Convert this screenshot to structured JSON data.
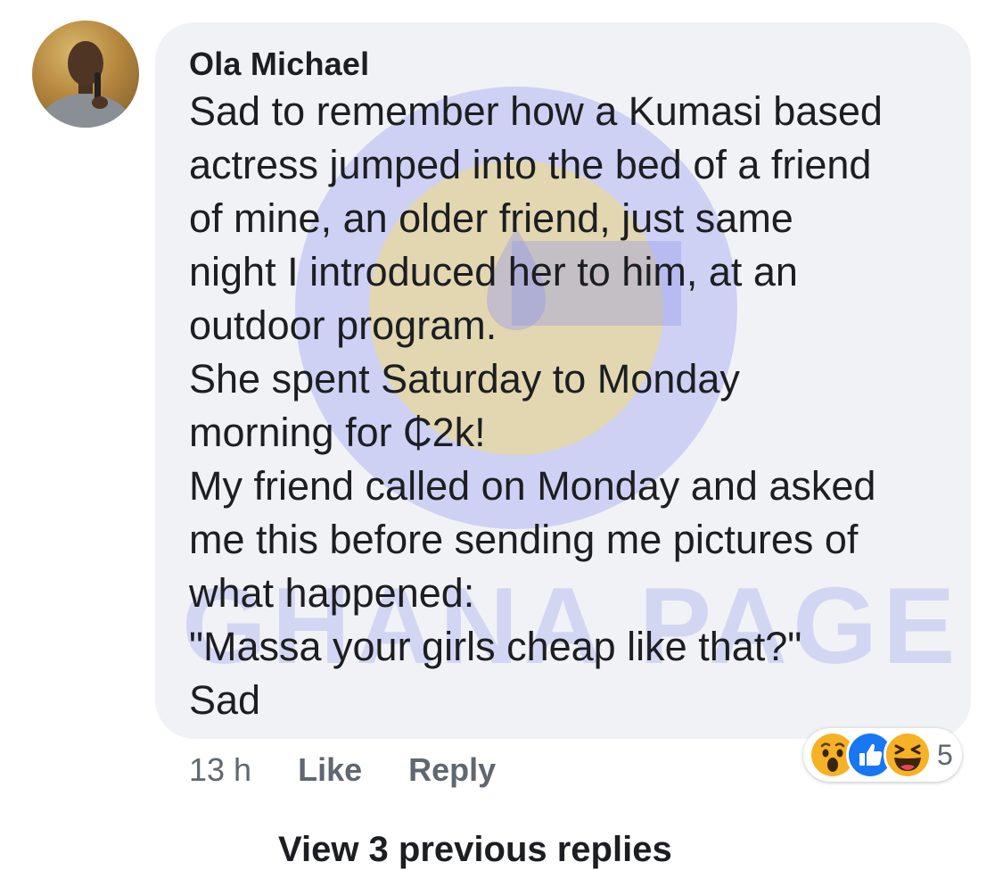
{
  "comment": {
    "author": "Ola Michael",
    "lines": [
      "Sad to remember how a Kumasi based",
      "actress jumped into the bed of a friend",
      "of mine, an older friend, just same",
      "night I introduced her to him, at an",
      "outdoor program.",
      "She spent Saturday to Monday",
      "morning for ₵2k!",
      "My friend called on Monday and asked",
      "me this before sending me pictures of",
      "what happened:",
      "\"Massa your girls cheap like that?\"",
      "Sad"
    ],
    "timestamp": "13 h",
    "like_label": "Like",
    "reply_label": "Reply",
    "reactions": {
      "icons": [
        "wow-icon",
        "like-icon",
        "haha-icon"
      ],
      "count": "5"
    }
  },
  "watermark": {
    "text": "GHANA PAGE"
  },
  "view_replies_label": "View 3 previous replies",
  "colors": {
    "bubble": "#f0f2f5",
    "text": "#1c1e21",
    "meta": "#606770",
    "like_blue": "#1877f2",
    "emoji_yellow": "#f7b125",
    "watermark_blue": "#8a8ff0",
    "watermark_yellow": "#f2dc7a"
  }
}
